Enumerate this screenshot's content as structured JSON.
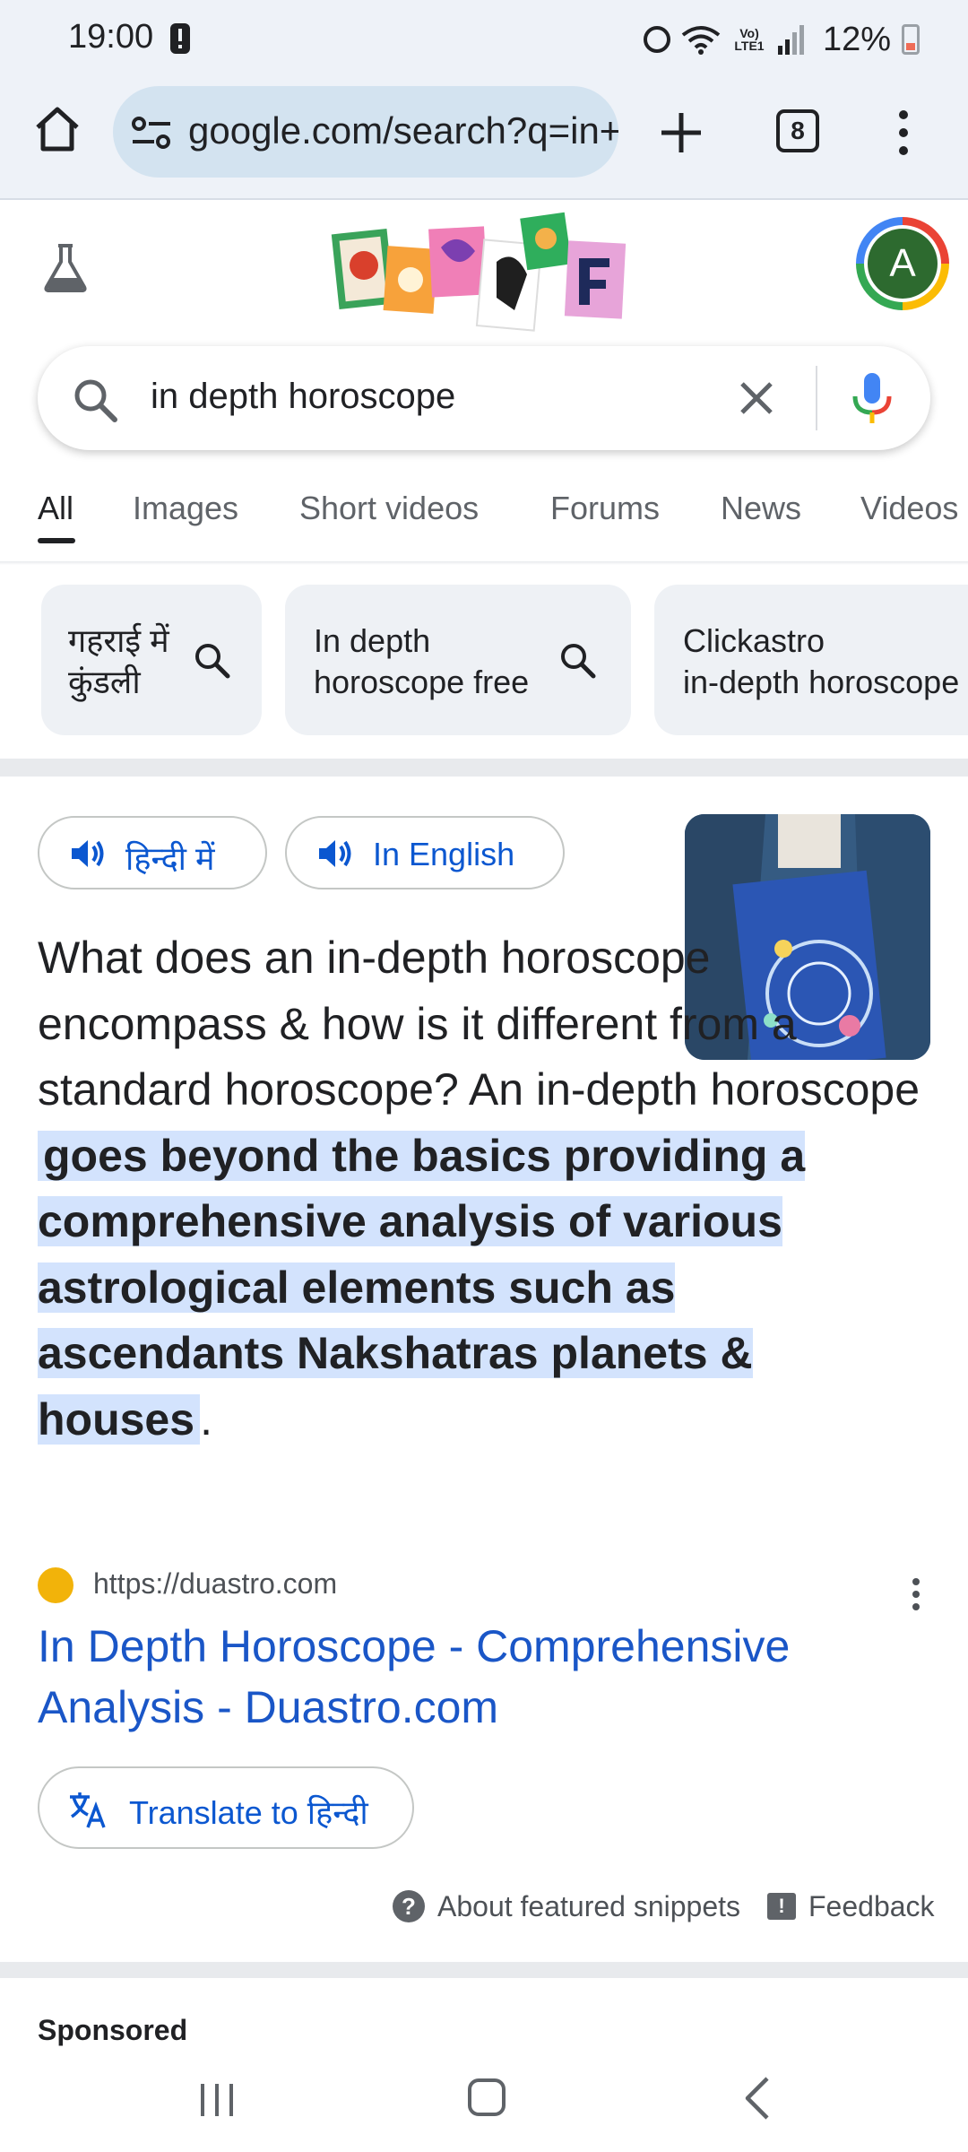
{
  "status_bar": {
    "time": "19:00",
    "battery": "12%",
    "network_label": "Vo) LTE1"
  },
  "browser": {
    "url": "google.com/search?q=in+depth+horoscope",
    "tab_count": "8"
  },
  "google": {
    "avatar_initial": "A"
  },
  "search": {
    "query": "in depth horoscope"
  },
  "tabs": [
    "All",
    "Images",
    "Short videos",
    "Forums",
    "News",
    "Videos"
  ],
  "chips": [
    {
      "line1": "गहराई में",
      "line2": "कुंडली"
    },
    {
      "line1": "In depth",
      "line2": "horoscope free"
    },
    {
      "line1": "Clickastro",
      "line2": "in-depth horoscope"
    }
  ],
  "snippet": {
    "lang_hindi": "हिन्दी में",
    "lang_english": "In English",
    "text_before": "What does an in-depth horoscope encompass & how is it different from a standard horoscope? An in-depth horoscope ",
    "text_highlight": "goes beyond the basics providing a comprehensive analysis of various astrological elements such as ascendants Nakshatras planets & houses",
    "text_after": "."
  },
  "result": {
    "source_url": "https://duastro.com",
    "title": "In Depth Horoscope - Comprehensive Analysis - Duastro.com",
    "translate_label": "Translate to हिन्दी"
  },
  "footer": {
    "about_snippets": "About featured snippets",
    "feedback": "Feedback",
    "sponsored": "Sponsored"
  },
  "colors": {
    "link_blue": "#1a56c7",
    "highlight": "#d3e3fd",
    "chrome_bg": "#eef2f8"
  }
}
